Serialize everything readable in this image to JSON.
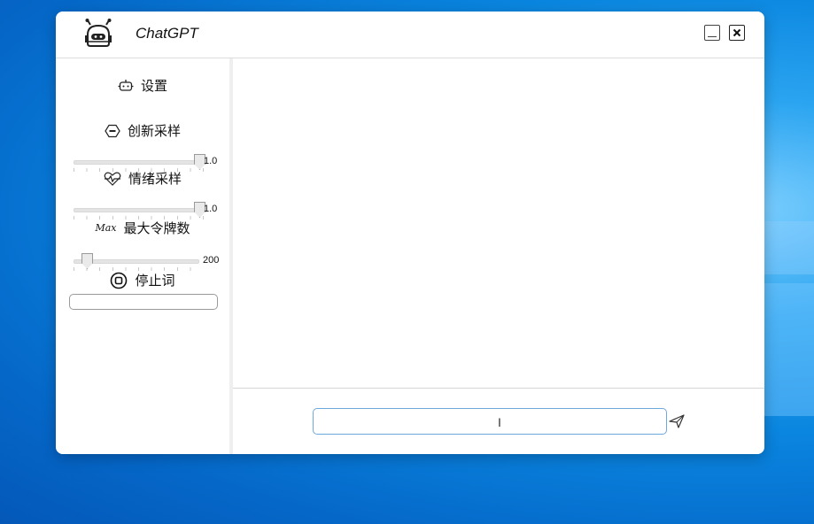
{
  "window": {
    "title": "ChatGPT"
  },
  "sidebar": {
    "settings_label": "设置",
    "innovation": {
      "label": "创新采样",
      "value": "1.0",
      "level": 1.0
    },
    "emotion": {
      "label": "情绪采样",
      "value": "1.0",
      "level": 1.0
    },
    "max_tokens": {
      "icon_text": "Max",
      "label": "最大令牌数",
      "value": "200",
      "level": 0.1
    },
    "stop_words": {
      "label": "停止词",
      "value": ""
    }
  },
  "footer": {
    "message_value": "",
    "cursor_glyph": "I"
  },
  "colors": {
    "accent": "#6fa8dc",
    "desktop": "#0a86e0"
  }
}
